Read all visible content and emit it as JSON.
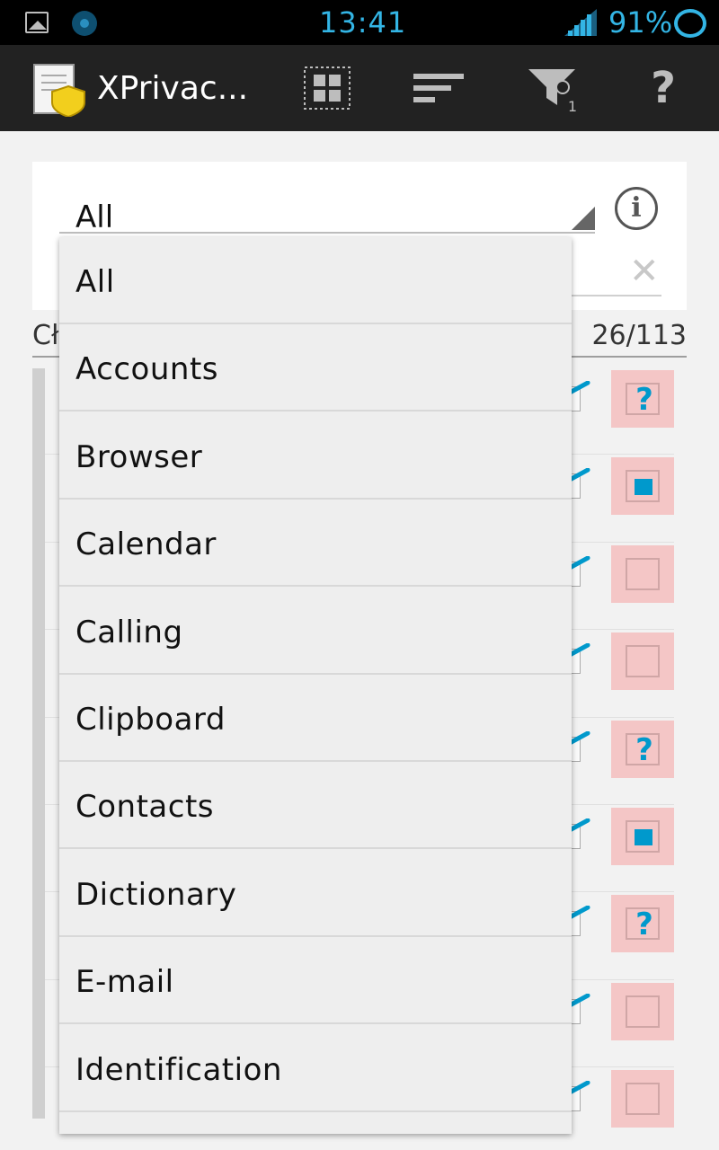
{
  "status_bar": {
    "time": "13:41",
    "battery": "91%",
    "icons": [
      "gallery-icon",
      "sync-dot-icon",
      "signal-icon",
      "battery-ring-icon"
    ]
  },
  "action_bar": {
    "title": "XPrivac...",
    "filter_count": "1",
    "help_label": "?",
    "icons": [
      "xprivacy-app-icon",
      "select-all-icon",
      "sort-icon",
      "filter-icon",
      "help-icon"
    ]
  },
  "filter": {
    "selected_category": "All",
    "info_label": "i",
    "clear_label": "✕"
  },
  "list_header": {
    "left_label": "Cł",
    "count": "26/113"
  },
  "rows": [
    {
      "state": "question"
    },
    {
      "state": "checked"
    },
    {
      "state": "empty"
    },
    {
      "state": "empty"
    },
    {
      "state": "question"
    },
    {
      "state": "checked"
    },
    {
      "state": "question"
    },
    {
      "state": "empty"
    },
    {
      "state": "empty"
    }
  ],
  "dropdown": {
    "items": [
      "All",
      "Accounts",
      "Browser",
      "Calendar",
      "Calling",
      "Clipboard",
      "Contacts",
      "Dictionary",
      "E-mail",
      "Identification"
    ]
  },
  "colors": {
    "accent": "#33b5e5",
    "restricted_bg": "#f4c6c6",
    "check_fill": "#0099cc",
    "action_bar": "#222222"
  }
}
